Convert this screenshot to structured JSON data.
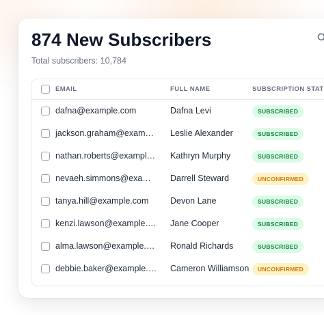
{
  "header": {
    "title": "874 New Subscribers",
    "subtitle": "Total subscribers: 10,784"
  },
  "icons": {
    "search": "search-icon"
  },
  "table": {
    "columns": [
      "EMAIL",
      "FULL NAME",
      "SUBSCRIPTION STATUS"
    ],
    "rows": [
      {
        "email": "dafna@example.com",
        "name": "Dafna Levi",
        "status": "SUBSCRIBED"
      },
      {
        "email": "jackson.graham@exampl...",
        "name": "Leslie Alexander",
        "status": "SUBSCRIBED"
      },
      {
        "email": "nathan.roberts@example....",
        "name": "Kathryn Murphy",
        "status": "SUBSCRIBED"
      },
      {
        "email": "nevaeh.simmons@exampl...",
        "name": "Darrell Steward",
        "status": "UNCONFIRMED"
      },
      {
        "email": "tanya.hill@example.com",
        "name": "Devon Lane",
        "status": "SUBSCRIBED"
      },
      {
        "email": "kenzi.lawson@example.co...",
        "name": "Jane Cooper",
        "status": "SUBSCRIBED"
      },
      {
        "email": "alma.lawson@example.co...",
        "name": "Ronald Richards",
        "status": "SUBSCRIBED"
      },
      {
        "email": "debbie.baker@example.co...",
        "name": "Cameron Williamson",
        "status": "UNCONFIRMED"
      }
    ]
  },
  "colors": {
    "subscribed_bg": "#dcfce7",
    "subscribed_text": "#15803d",
    "unconfirmed_bg": "#fef3c7",
    "unconfirmed_text": "#d97706"
  }
}
